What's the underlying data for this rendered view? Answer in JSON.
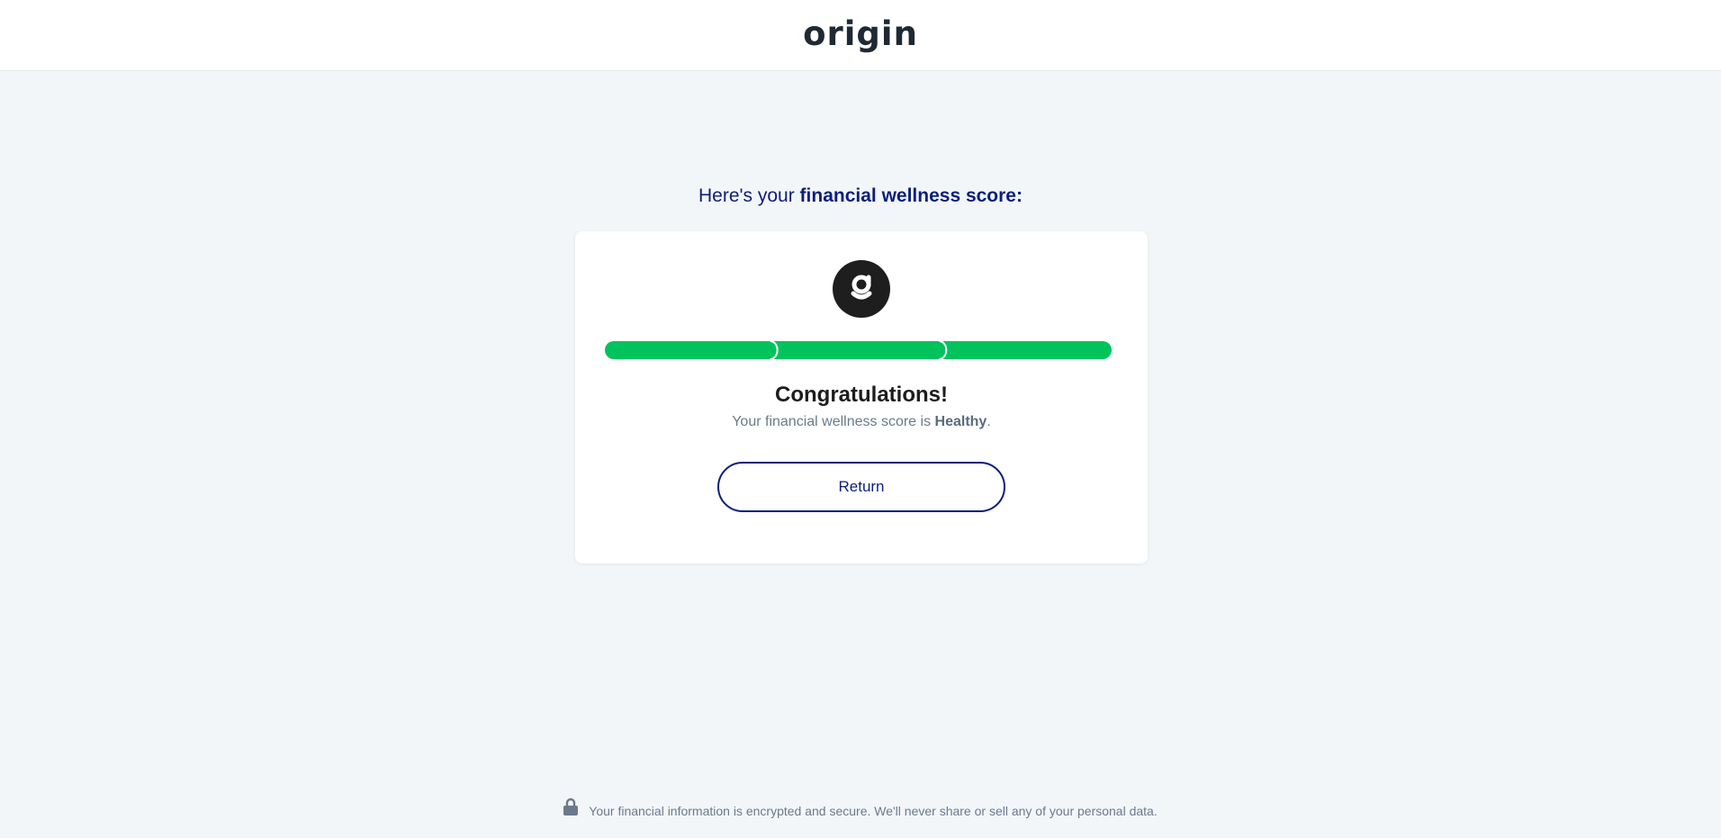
{
  "header": {
    "logo_text": "origin"
  },
  "main": {
    "heading_prefix": "Here's your ",
    "heading_emphasis": "financial wellness score:",
    "card": {
      "badge_icon": "origin-g-icon",
      "score_segments": 3,
      "score_filled_segments": 3,
      "score_color": "#00c35c",
      "title": "Congratulations!",
      "subtitle_prefix": "Your financial wellness score is ",
      "subtitle_value": "Healthy",
      "subtitle_suffix": ".",
      "return_label": "Return"
    }
  },
  "footer": {
    "lock_icon": "lock-icon",
    "note": "Your financial information is encrypted and secure. We'll never share or sell any of your personal data."
  },
  "colors": {
    "brand_navy": "#0c1f7a",
    "success_green": "#00c35c",
    "page_background": "#f3f6f9",
    "muted_text": "#6b7a8c"
  }
}
